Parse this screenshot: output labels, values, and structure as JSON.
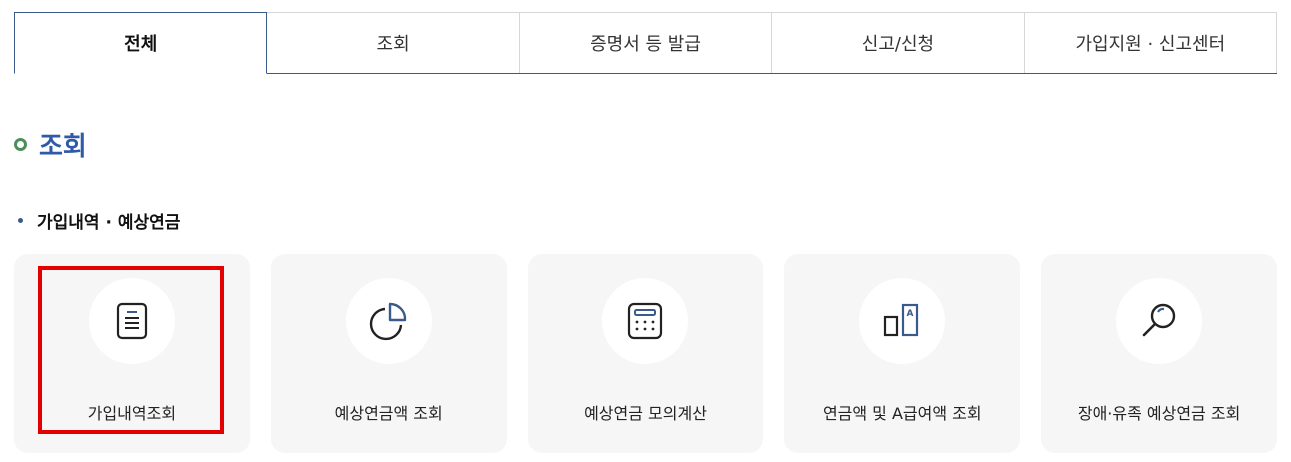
{
  "tabs": [
    {
      "label": "전체",
      "active": true
    },
    {
      "label": "조회",
      "active": false
    },
    {
      "label": "증명서 등 발급",
      "active": false
    },
    {
      "label": "신고/신청",
      "active": false
    },
    {
      "label": "가입지원 · 신고센터",
      "active": false
    }
  ],
  "section": {
    "title": "조회"
  },
  "subsection": {
    "title": "가입내역 · 예상연금"
  },
  "cards": [
    {
      "label": "가입내역조회",
      "icon": "document-icon"
    },
    {
      "label": "예상연금액 조회",
      "icon": "pie-chart-icon"
    },
    {
      "label": "예상연금 모의계산",
      "icon": "calculator-icon"
    },
    {
      "label": "연금액 및 A급여액 조회",
      "icon": "bar-a-icon"
    },
    {
      "label": "장애·유족 예상연금 조회",
      "icon": "magnifier-icon"
    }
  ],
  "colors": {
    "accent": "#2e5aa6",
    "tab_border": "#3b5a8c",
    "ring": "#4a8f5a",
    "highlight": "#e40000",
    "card_bg": "#f6f6f6"
  }
}
